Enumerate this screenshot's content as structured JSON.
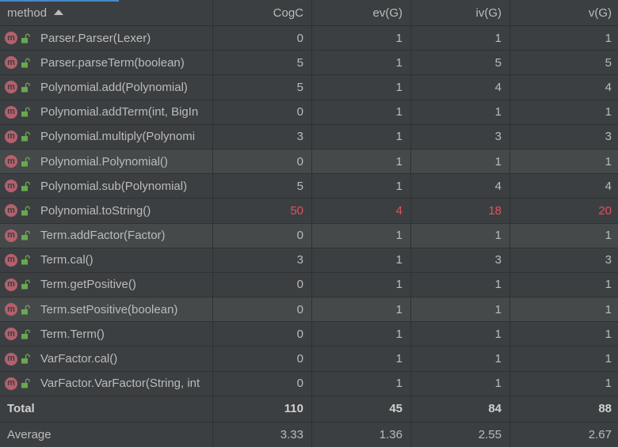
{
  "columns": {
    "method": "method",
    "cogc": "CogC",
    "ev": "ev(G)",
    "iv": "iv(G)",
    "v": "v(G)"
  },
  "colors": {
    "method_icon": "#b5606d",
    "lock_icon": "#6aa84f",
    "highlight": "#e2525c",
    "selection": "#4a88c7"
  },
  "rows": [
    {
      "icon": "m",
      "method": "Parser.Parser(Lexer)",
      "cogc": "0",
      "ev": "1",
      "iv": "1",
      "v": "1"
    },
    {
      "icon": "m",
      "method": "Parser.parseTerm(boolean)",
      "cogc": "5",
      "ev": "1",
      "iv": "5",
      "v": "5"
    },
    {
      "icon": "m",
      "method": "Polynomial.add(Polynomial)",
      "cogc": "5",
      "ev": "1",
      "iv": "4",
      "v": "4"
    },
    {
      "icon": "m",
      "method": "Polynomial.addTerm(int, BigIn",
      "cogc": "0",
      "ev": "1",
      "iv": "1",
      "v": "1"
    },
    {
      "icon": "m",
      "method": "Polynomial.multiply(Polynomi",
      "cogc": "3",
      "ev": "1",
      "iv": "3",
      "v": "3"
    },
    {
      "icon": "m",
      "method": "Polynomial.Polynomial()",
      "cogc": "0",
      "ev": "1",
      "iv": "1",
      "v": "1"
    },
    {
      "icon": "m",
      "method": "Polynomial.sub(Polynomial)",
      "cogc": "5",
      "ev": "1",
      "iv": "4",
      "v": "4"
    },
    {
      "icon": "m",
      "method": "Polynomial.toString()",
      "cogc": "50",
      "ev": "4",
      "iv": "18",
      "v": "20"
    },
    {
      "icon": "m",
      "method": "Term.addFactor(Factor)",
      "cogc": "0",
      "ev": "1",
      "iv": "1",
      "v": "1"
    },
    {
      "icon": "m",
      "method": "Term.cal()",
      "cogc": "3",
      "ev": "1",
      "iv": "3",
      "v": "3"
    },
    {
      "icon": "m",
      "method": "Term.getPositive()",
      "cogc": "0",
      "ev": "1",
      "iv": "1",
      "v": "1"
    },
    {
      "icon": "m",
      "method": "Term.setPositive(boolean)",
      "cogc": "0",
      "ev": "1",
      "iv": "1",
      "v": "1"
    },
    {
      "icon": "m",
      "method": "Term.Term()",
      "cogc": "0",
      "ev": "1",
      "iv": "1",
      "v": "1"
    },
    {
      "icon": "m",
      "method": "VarFactor.cal()",
      "cogc": "0",
      "ev": "1",
      "iv": "1",
      "v": "1"
    },
    {
      "icon": "m",
      "method": "VarFactor.VarFactor(String, int",
      "cogc": "0",
      "ev": "1",
      "iv": "1",
      "v": "1"
    }
  ],
  "total": {
    "label": "Total",
    "cogc": "110",
    "ev": "45",
    "iv": "84",
    "v": "88"
  },
  "average": {
    "label": "Average",
    "cogc": "3.33",
    "ev": "1.36",
    "iv": "2.55",
    "v": "2.67"
  }
}
